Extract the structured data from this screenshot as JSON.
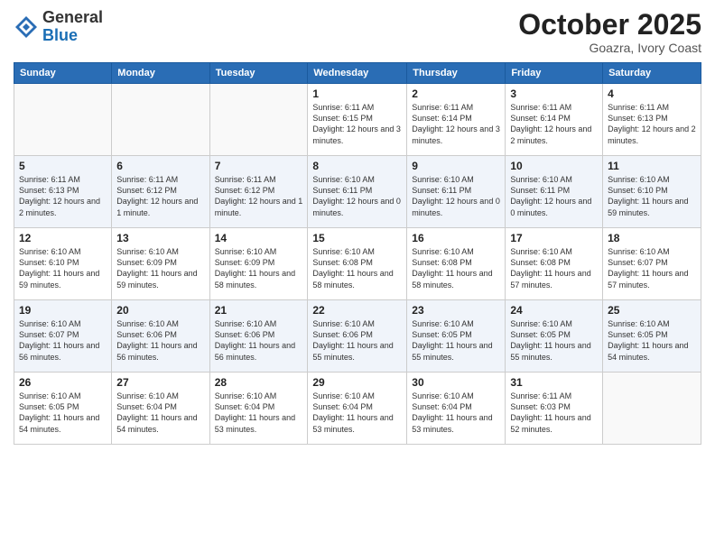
{
  "logo": {
    "line1": "General",
    "line2": "Blue"
  },
  "title": "October 2025",
  "location": "Goazra, Ivory Coast",
  "weekdays": [
    "Sunday",
    "Monday",
    "Tuesday",
    "Wednesday",
    "Thursday",
    "Friday",
    "Saturday"
  ],
  "weeks": [
    [
      {
        "day": "",
        "info": ""
      },
      {
        "day": "",
        "info": ""
      },
      {
        "day": "",
        "info": ""
      },
      {
        "day": "1",
        "info": "Sunrise: 6:11 AM\nSunset: 6:15 PM\nDaylight: 12 hours and 3 minutes."
      },
      {
        "day": "2",
        "info": "Sunrise: 6:11 AM\nSunset: 6:14 PM\nDaylight: 12 hours and 3 minutes."
      },
      {
        "day": "3",
        "info": "Sunrise: 6:11 AM\nSunset: 6:14 PM\nDaylight: 12 hours and 2 minutes."
      },
      {
        "day": "4",
        "info": "Sunrise: 6:11 AM\nSunset: 6:13 PM\nDaylight: 12 hours and 2 minutes."
      }
    ],
    [
      {
        "day": "5",
        "info": "Sunrise: 6:11 AM\nSunset: 6:13 PM\nDaylight: 12 hours and 2 minutes."
      },
      {
        "day": "6",
        "info": "Sunrise: 6:11 AM\nSunset: 6:12 PM\nDaylight: 12 hours and 1 minute."
      },
      {
        "day": "7",
        "info": "Sunrise: 6:11 AM\nSunset: 6:12 PM\nDaylight: 12 hours and 1 minute."
      },
      {
        "day": "8",
        "info": "Sunrise: 6:10 AM\nSunset: 6:11 PM\nDaylight: 12 hours and 0 minutes."
      },
      {
        "day": "9",
        "info": "Sunrise: 6:10 AM\nSunset: 6:11 PM\nDaylight: 12 hours and 0 minutes."
      },
      {
        "day": "10",
        "info": "Sunrise: 6:10 AM\nSunset: 6:11 PM\nDaylight: 12 hours and 0 minutes."
      },
      {
        "day": "11",
        "info": "Sunrise: 6:10 AM\nSunset: 6:10 PM\nDaylight: 11 hours and 59 minutes."
      }
    ],
    [
      {
        "day": "12",
        "info": "Sunrise: 6:10 AM\nSunset: 6:10 PM\nDaylight: 11 hours and 59 minutes."
      },
      {
        "day": "13",
        "info": "Sunrise: 6:10 AM\nSunset: 6:09 PM\nDaylight: 11 hours and 59 minutes."
      },
      {
        "day": "14",
        "info": "Sunrise: 6:10 AM\nSunset: 6:09 PM\nDaylight: 11 hours and 58 minutes."
      },
      {
        "day": "15",
        "info": "Sunrise: 6:10 AM\nSunset: 6:08 PM\nDaylight: 11 hours and 58 minutes."
      },
      {
        "day": "16",
        "info": "Sunrise: 6:10 AM\nSunset: 6:08 PM\nDaylight: 11 hours and 58 minutes."
      },
      {
        "day": "17",
        "info": "Sunrise: 6:10 AM\nSunset: 6:08 PM\nDaylight: 11 hours and 57 minutes."
      },
      {
        "day": "18",
        "info": "Sunrise: 6:10 AM\nSunset: 6:07 PM\nDaylight: 11 hours and 57 minutes."
      }
    ],
    [
      {
        "day": "19",
        "info": "Sunrise: 6:10 AM\nSunset: 6:07 PM\nDaylight: 11 hours and 56 minutes."
      },
      {
        "day": "20",
        "info": "Sunrise: 6:10 AM\nSunset: 6:06 PM\nDaylight: 11 hours and 56 minutes."
      },
      {
        "day": "21",
        "info": "Sunrise: 6:10 AM\nSunset: 6:06 PM\nDaylight: 11 hours and 56 minutes."
      },
      {
        "day": "22",
        "info": "Sunrise: 6:10 AM\nSunset: 6:06 PM\nDaylight: 11 hours and 55 minutes."
      },
      {
        "day": "23",
        "info": "Sunrise: 6:10 AM\nSunset: 6:05 PM\nDaylight: 11 hours and 55 minutes."
      },
      {
        "day": "24",
        "info": "Sunrise: 6:10 AM\nSunset: 6:05 PM\nDaylight: 11 hours and 55 minutes."
      },
      {
        "day": "25",
        "info": "Sunrise: 6:10 AM\nSunset: 6:05 PM\nDaylight: 11 hours and 54 minutes."
      }
    ],
    [
      {
        "day": "26",
        "info": "Sunrise: 6:10 AM\nSunset: 6:05 PM\nDaylight: 11 hours and 54 minutes."
      },
      {
        "day": "27",
        "info": "Sunrise: 6:10 AM\nSunset: 6:04 PM\nDaylight: 11 hours and 54 minutes."
      },
      {
        "day": "28",
        "info": "Sunrise: 6:10 AM\nSunset: 6:04 PM\nDaylight: 11 hours and 53 minutes."
      },
      {
        "day": "29",
        "info": "Sunrise: 6:10 AM\nSunset: 6:04 PM\nDaylight: 11 hours and 53 minutes."
      },
      {
        "day": "30",
        "info": "Sunrise: 6:10 AM\nSunset: 6:04 PM\nDaylight: 11 hours and 53 minutes."
      },
      {
        "day": "31",
        "info": "Sunrise: 6:11 AM\nSunset: 6:03 PM\nDaylight: 11 hours and 52 minutes."
      },
      {
        "day": "",
        "info": ""
      }
    ]
  ]
}
